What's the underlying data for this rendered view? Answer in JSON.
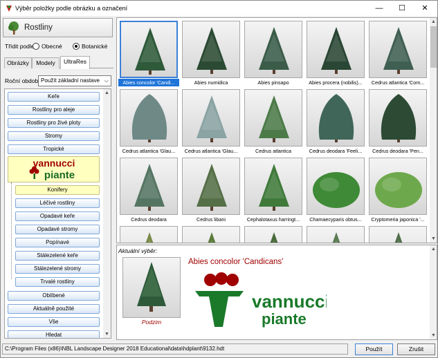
{
  "window": {
    "title": "Výběr položky podle obrázku a označení",
    "min_glyph": "—",
    "max_glyph": "☐",
    "close_glyph": "✕"
  },
  "category": {
    "title": "Rostliny",
    "icon": "plant-icon"
  },
  "sort": {
    "label": "Třídit podle",
    "options": [
      "Obecné",
      "Botanické"
    ],
    "selected": "Botanické"
  },
  "tabs": [
    "Obrázky",
    "Modely",
    "UltraRes"
  ],
  "active_tab": "UltraRes",
  "season": {
    "label": "Roční obdob",
    "value": "Použít základní nastave"
  },
  "list_items": [
    "Keře",
    "Rostliny pro aleje",
    "Rostliny pro živé ploty",
    "Stromy",
    "Tropické"
  ],
  "vannucci": {
    "line1": "vannucci",
    "line2": "piante"
  },
  "sub_items": [
    "Konifery",
    "Léčivé rostliny",
    "Opadavé keře",
    "Opadavé stromy",
    "Popínavé",
    "Stálezelené keře",
    "Stálezelené stromy",
    "Trvalé rostliny"
  ],
  "selected_sub": "Konifery",
  "bottom_items": [
    "Oblíbené",
    "Aktuálně použité",
    "Vše",
    "Hledat"
  ],
  "grid": [
    {
      "caption": "Abies concolor 'Candi...",
      "shape": "cone",
      "color": "#2f5a3a"
    },
    {
      "caption": "Abies numidica",
      "shape": "cone",
      "color": "#2b4a33"
    },
    {
      "caption": "Abies pinsapo",
      "shape": "cone",
      "color": "#3a5c48"
    },
    {
      "caption": "Abies procera (nobilis)...",
      "shape": "cone",
      "color": "#2a4634"
    },
    {
      "caption": "Cedrus atlantica 'Com...",
      "shape": "cone",
      "color": "#3f5f52"
    },
    {
      "caption": "Cedrus atlantica 'Glau...",
      "shape": "weep",
      "color": "#6f8a86"
    },
    {
      "caption": "Cedrus atlantica 'Glau...",
      "shape": "cone",
      "color": "#8aa3a3"
    },
    {
      "caption": "Cedrus atlantica",
      "shape": "cone",
      "color": "#4c7a48"
    },
    {
      "caption": "Cedrus deodara 'Feeli...",
      "shape": "weep",
      "color": "#3f6658"
    },
    {
      "caption": "Cedrus deodara 'Pen...",
      "shape": "weep",
      "color": "#2c4a34"
    },
    {
      "caption": "Cedrus deodara",
      "shape": "cone",
      "color": "#557563"
    },
    {
      "caption": "Cedrus libani",
      "shape": "cone",
      "color": "#556f47"
    },
    {
      "caption": "Cephalotaxus harringt...",
      "shape": "cone",
      "color": "#3f7a3a"
    },
    {
      "caption": "Chamaecyparis obtus...",
      "shape": "bush",
      "color": "#3f8a36"
    },
    {
      "caption": "Cryptomeria japonica '...",
      "shape": "bush",
      "color": "#6ea84c"
    },
    {
      "caption": "",
      "shape": "cone",
      "color": "#7a8a4a"
    },
    {
      "caption": "",
      "shape": "cone",
      "color": "#5b7a3a"
    },
    {
      "caption": "",
      "shape": "cone",
      "color": "#4a6a3a"
    },
    {
      "caption": "",
      "shape": "cone",
      "color": "#5a7a52"
    },
    {
      "caption": "",
      "shape": "cone",
      "color": "#4f6f4a"
    }
  ],
  "selected_tile": 0,
  "detail": {
    "label": "Aktuální výběr:",
    "name": "Abies concolor 'Candicans'",
    "season": "Podzim",
    "logo_line1": "vannucci",
    "logo_line2": "piante"
  },
  "status_path": "C:\\Program Files (x86)\\NBL Landscape Designer 2018 Educational\\data\\hdplant\\9132.hdt",
  "buttons": {
    "ok": "Použít",
    "cancel": "Zrušit"
  },
  "colors": {
    "accent": "#1e74d8",
    "brand_red": "#a00000",
    "brand_green": "#1a7a2a",
    "selected_bg": "#ffffc0"
  }
}
